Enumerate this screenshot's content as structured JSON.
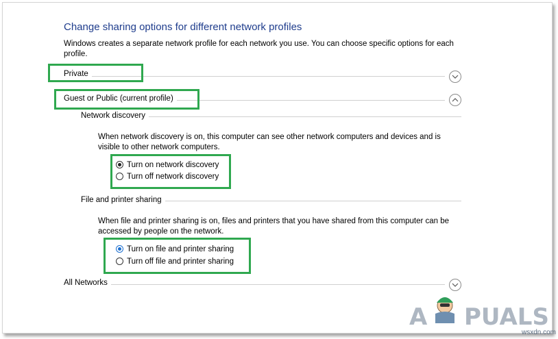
{
  "title": "Change sharing options for different network profiles",
  "intro": "Windows creates a separate network profile for each network you use. You can choose specific options for each profile.",
  "profiles": {
    "private": "Private",
    "guest_public": "Guest or Public (current profile)",
    "all_networks": "All Networks"
  },
  "network_discovery": {
    "heading": "Network discovery",
    "description": "When network discovery is on, this computer can see other network computers and devices and is visible to other network computers.",
    "options": [
      "Turn on network discovery",
      "Turn off network discovery"
    ],
    "selected": "Turn on network discovery"
  },
  "file_sharing": {
    "heading": "File and printer sharing",
    "description": "When file and printer sharing is on, files and printers that you have shared from this computer can be accessed by people on the network.",
    "options": [
      "Turn on file and printer sharing",
      "Turn off file and printer sharing"
    ],
    "selected": "Turn on file and printer sharing"
  },
  "watermark": {
    "brand": "APPUALS",
    "site": "wsxdn.com"
  },
  "colors": {
    "title": "#1e3c8c",
    "highlight": "#2fa84f",
    "radio_selected": "#1c6fd0"
  }
}
